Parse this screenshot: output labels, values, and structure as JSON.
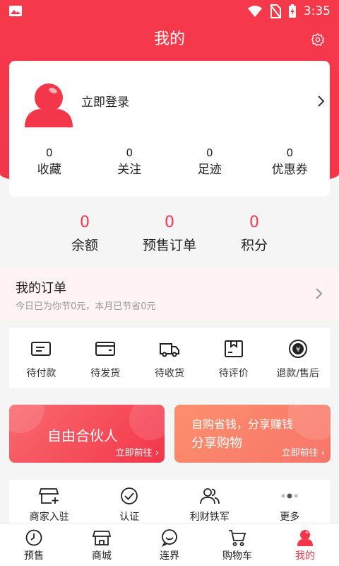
{
  "status_bar": {
    "time": "3:35"
  },
  "header": {
    "title": "我的"
  },
  "profile": {
    "login_label": "立即登录"
  },
  "stats": [
    {
      "count": "0",
      "label": "收藏"
    },
    {
      "count": "0",
      "label": "关注"
    },
    {
      "count": "0",
      "label": "足迹"
    },
    {
      "count": "0",
      "label": "优惠券"
    }
  ],
  "wallet": [
    {
      "count": "0",
      "label": "余额"
    },
    {
      "count": "0",
      "label": "预售订单"
    },
    {
      "count": "0",
      "label": "积分"
    }
  ],
  "orders": {
    "title": "我的订单",
    "subtitle": "今日已为你节0元，本月已节省0元"
  },
  "order_status": [
    {
      "label": "待付款",
      "icon": "wallet-icon"
    },
    {
      "label": "待发货",
      "icon": "card-icon"
    },
    {
      "label": "待收货",
      "icon": "truck-icon"
    },
    {
      "label": "待评价",
      "icon": "review-box-icon"
    },
    {
      "label": "退款/售后",
      "icon": "refund-coin-icon"
    }
  ],
  "promos": {
    "partner": {
      "title": "自由合伙人",
      "go": "立即前往"
    },
    "share": {
      "line1": "自购省钱，分享赚钱",
      "line2": "分享购物",
      "go": "立即前往"
    }
  },
  "services": [
    {
      "label": "商家入驻",
      "icon": "store-add-icon"
    },
    {
      "label": "认证",
      "icon": "check-circle-icon"
    },
    {
      "label": "利财铁军",
      "icon": "users-icon"
    },
    {
      "label": "更多",
      "icon": "more-dots-icon"
    }
  ],
  "tabs": [
    {
      "label": "预售",
      "icon": "clock-icon"
    },
    {
      "label": "商城",
      "icon": "store-icon"
    },
    {
      "label": "连界",
      "icon": "chat-icon"
    },
    {
      "label": "购物车",
      "icon": "cart-icon"
    },
    {
      "label": "我的",
      "icon": "profile-icon"
    }
  ],
  "colors": {
    "accent": "#f4364a",
    "background": "#f5f5f5"
  }
}
